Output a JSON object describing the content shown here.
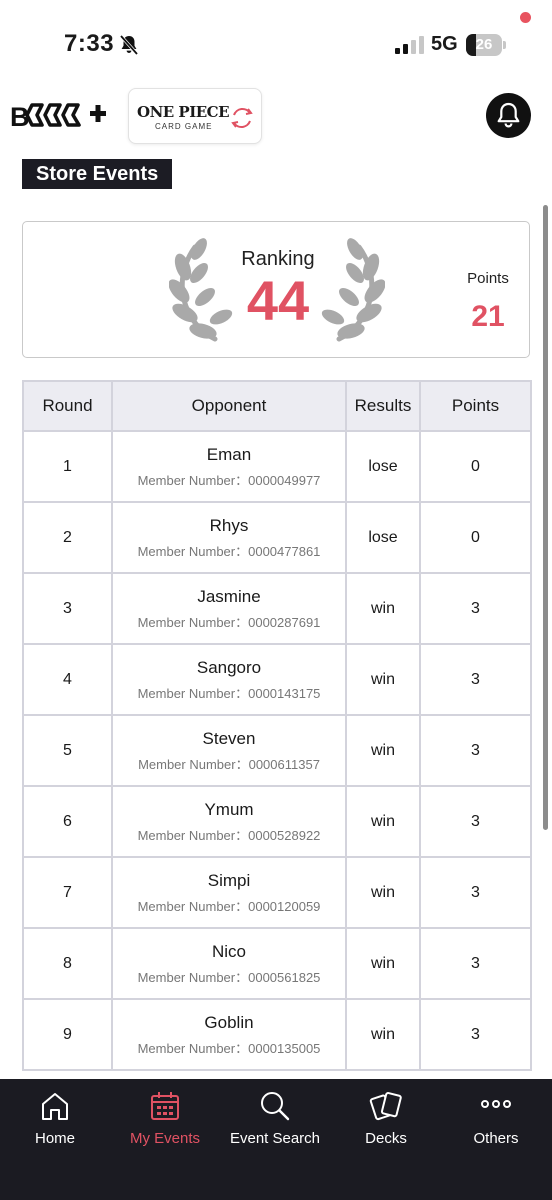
{
  "status_bar": {
    "time": "7:33",
    "network": "5G",
    "battery": "26",
    "battery_percent": 26
  },
  "header": {
    "brand_logo_icon": "bcg-plus-logo",
    "game_logo": {
      "title": "ONE PIECE",
      "subtitle": "CARD GAME"
    },
    "notification_icon": "bell-icon",
    "has_unread": true
  },
  "section_title": "Store Events",
  "ranking": {
    "label": "Ranking",
    "value": "44",
    "points_label": "Points",
    "points_value": "21"
  },
  "table": {
    "headers": [
      "Round",
      "Opponent",
      "Results",
      "Points"
    ],
    "member_prefix": "Member Number：",
    "rows": [
      {
        "round": "1",
        "opponent": "Eman",
        "member": "Member Number：0000049977",
        "result": "lose",
        "points": "0"
      },
      {
        "round": "2",
        "opponent": "Rhys",
        "member": "Member Number：0000477861",
        "result": "lose",
        "points": "0"
      },
      {
        "round": "3",
        "opponent": "Jasmine",
        "member": "Member Number：0000287691",
        "result": "win",
        "points": "3"
      },
      {
        "round": "4",
        "opponent": "Sangoro",
        "member": "Member Number：0000143175",
        "result": "win",
        "points": "3"
      },
      {
        "round": "5",
        "opponent": "Steven",
        "member": "Member Number：0000611357",
        "result": "win",
        "points": "3"
      },
      {
        "round": "6",
        "opponent": "Ymum",
        "member": "Member Number：0000528922",
        "result": "win",
        "points": "3"
      },
      {
        "round": "7",
        "opponent": "Simpi",
        "member": "Member Number：0000120059",
        "result": "win",
        "points": "3"
      },
      {
        "round": "8",
        "opponent": "Nico",
        "member": "Member Number：0000561825",
        "result": "win",
        "points": "3"
      },
      {
        "round": "9",
        "opponent": "Goblin",
        "member": "Member Number：0000135005",
        "result": "win",
        "points": "3"
      }
    ]
  },
  "bottom_nav": {
    "items": [
      {
        "label": "Home",
        "icon": "home-icon",
        "active": false
      },
      {
        "label": "My Events",
        "icon": "calendar-icon",
        "active": true
      },
      {
        "label": "Event Search",
        "icon": "search-icon",
        "active": false
      },
      {
        "label": "Decks",
        "icon": "cards-icon",
        "active": false
      },
      {
        "label": "Others",
        "icon": "more-icon",
        "active": false
      }
    ]
  },
  "colors": {
    "accent": "#e05263",
    "nav_bg": "#1b1b22",
    "table_header_bg": "#ececf2"
  }
}
